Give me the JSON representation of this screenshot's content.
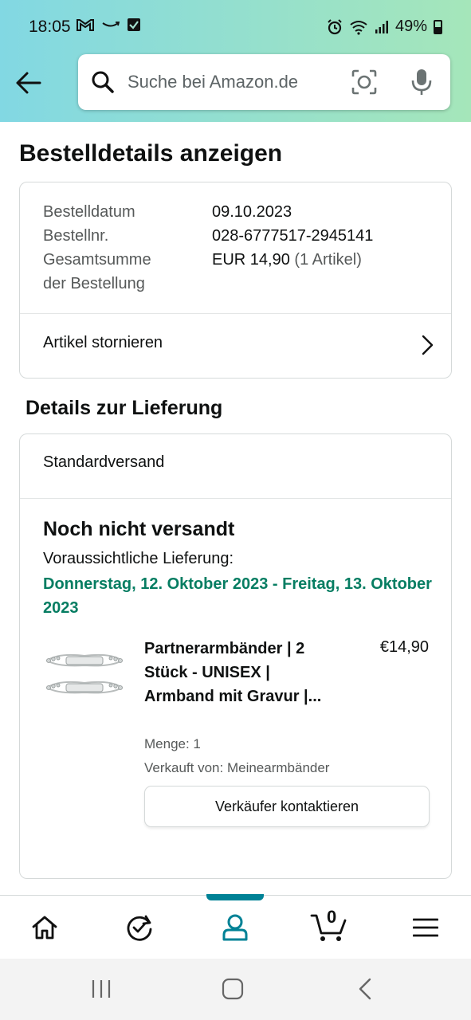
{
  "status_bar": {
    "time": "18:05",
    "battery": "49%"
  },
  "search": {
    "placeholder": "Suche bei Amazon.de"
  },
  "page_title": "Bestelldetails anzeigen",
  "order": {
    "date_label": "Bestelldatum",
    "date_value": "09.10.2023",
    "number_label": "Bestellnr.",
    "number_value": "028-6777517-2945141",
    "total_label_line1": "Gesamtsumme",
    "total_label_line2": "der Bestellung",
    "total_value": "EUR 14,90",
    "total_items": "(1 Artikel)",
    "cancel_label": "Artikel stornieren"
  },
  "delivery": {
    "section_title": "Details zur Lieferung",
    "method": "Standardversand",
    "status": "Noch nicht versandt",
    "estimate_label": "Voraussichtliche Lieferung:",
    "estimate_date": "Donnerstag, 12. Oktober 2023 - Freitag, 13. Oktober 2023"
  },
  "product": {
    "title": "Partnerarmbänder | 2 Stück - UNISEX | Armband mit Gravur |...",
    "price": "€14,90",
    "quantity": "Menge: 1",
    "seller": "Verkauft von: Meinearmbänder",
    "contact_button": "Verkäufer kontaktieren"
  },
  "bottom_nav": {
    "cart_count": "0",
    "active_item": "account"
  },
  "colors": {
    "accent_teal": "#008296",
    "delivery_green": "#067d62",
    "header_gradient_start": "#82d8e3",
    "header_gradient_end": "#a5e6ba"
  }
}
